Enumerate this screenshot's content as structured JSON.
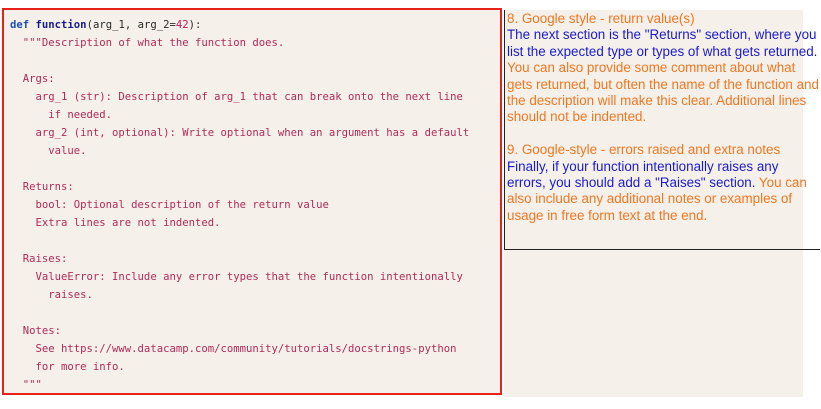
{
  "code": {
    "def_keyword": "def",
    "function_name": "function",
    "signature_start": "(arg_1, arg_2=",
    "default_value": "42",
    "signature_end": "):",
    "docstring_lines": [
      "  \"\"\"Description of what the function does.",
      "",
      "  Args:",
      "    arg_1 (str): Description of arg_1 that can break onto the next line",
      "      if needed.",
      "    arg_2 (int, optional): Write optional when an argument has a default",
      "      value.",
      "",
      "  Returns:",
      "    bool: Optional description of the return value",
      "    Extra lines are not indented.",
      "",
      "  Raises:",
      "    ValueError: Include any error types that the function intentionally",
      "      raises.",
      "",
      "  Notes:",
      "    See https://www.datacamp.com/community/tutorials/docstrings-python",
      "    for more info.",
      "  \"\"\""
    ]
  },
  "notes": {
    "section8": {
      "heading": "8. Google style - return value(s)",
      "blue_text": "The next section is the \"Returns\" section, where you list the expected type or types of what gets returned.",
      "orange_text": " You can also provide some comment about what gets returned, but often the name of the function and the description will make this clear. Additional lines should not be indented."
    },
    "section9": {
      "heading": "9. Google-style - errors raised and extra notes",
      "blue_text": "Finally, if your function intentionally raises any errors, you should add a \"Raises\" section.",
      "orange_text": " You can also include any additional notes or examples of usage in free form text at the end."
    }
  },
  "colors": {
    "frame_border": "#e8211b",
    "panel_background": "#f5f1ea",
    "heading_orange": "#ee7722",
    "body_blue": "#1a1acc"
  }
}
